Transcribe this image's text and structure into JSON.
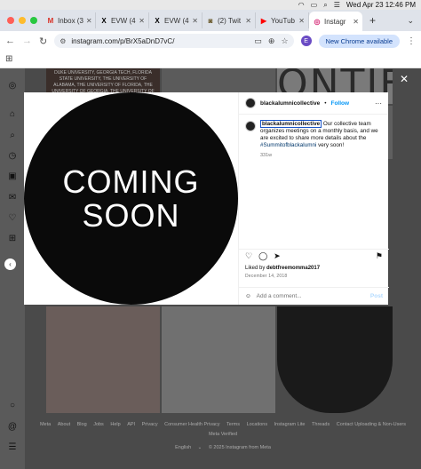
{
  "menubar": {
    "datetime": "Wed Apr 23  12:46 PM"
  },
  "tabs": [
    {
      "label": "Inbox (3",
      "favicon": "M",
      "favicon_color": "#d93025"
    },
    {
      "label": "EVW (4",
      "favicon": "X",
      "favicon_color": "#000000"
    },
    {
      "label": "EVW (4",
      "favicon": "X",
      "favicon_color": "#000000"
    },
    {
      "label": "(2) Twit",
      "favicon": "◙",
      "favicon_color": "#6b5b2e"
    },
    {
      "label": "YouTub",
      "favicon": "▶",
      "favicon_color": "#ff0000"
    },
    {
      "label": "Instagr",
      "favicon": "◎",
      "favicon_color": "#d62976",
      "active": true
    }
  ],
  "toolbar": {
    "url": "instagram.com/p/BrX5aDnD7vC/",
    "profile_initial": "E",
    "update_label": "New Chrome available"
  },
  "post": {
    "media_text_line1": "COMING",
    "media_text_line2": "SOON",
    "username": "blackalumnicollective",
    "follow_label": "Follow",
    "caption_user": "blackalumnicollective",
    "caption_text": " Our collective team organizes meetings on a monthly basis, and we are excited to share more details about the ",
    "hashtag": "#Summitofblackalumni",
    "caption_end": " very soon!",
    "caption_age": "331w",
    "liked_by_prefix": "Liked by ",
    "liked_by_user": "debtfreemomma2017",
    "date": "December 14, 2018",
    "comment_placeholder": "Add a comment...",
    "post_label": "Post"
  },
  "background": {
    "text_block": "DUKE UNIVERSITY, GEORGIA TECH, FLORIDA STATE UNIVERSITY, THE UNIVERSITY OF ALABAMA, THE UNIVERSITY OF FLORIDA, THE UNIVERSITY OF GEORGIA, THE UNIVERSITY OF NORTH CAROLINA, AND THE UNIVERSITY OF SOUTH CAROLINA.",
    "big_letters": "ONTIF"
  },
  "footer": {
    "links": [
      "Meta",
      "About",
      "Blog",
      "Jobs",
      "Help",
      "API",
      "Privacy",
      "Consumer Health Privacy",
      "Terms",
      "Locations",
      "Instagram Lite",
      "Threads",
      "Contact Uploading & Non-Users"
    ],
    "meta_verified": "Meta Verified",
    "language": "English",
    "copyright": "© 2025 Instagram from Meta"
  },
  "colors": {
    "accent": "#0095f6",
    "chrome_update_bg": "#d3e3fd"
  }
}
